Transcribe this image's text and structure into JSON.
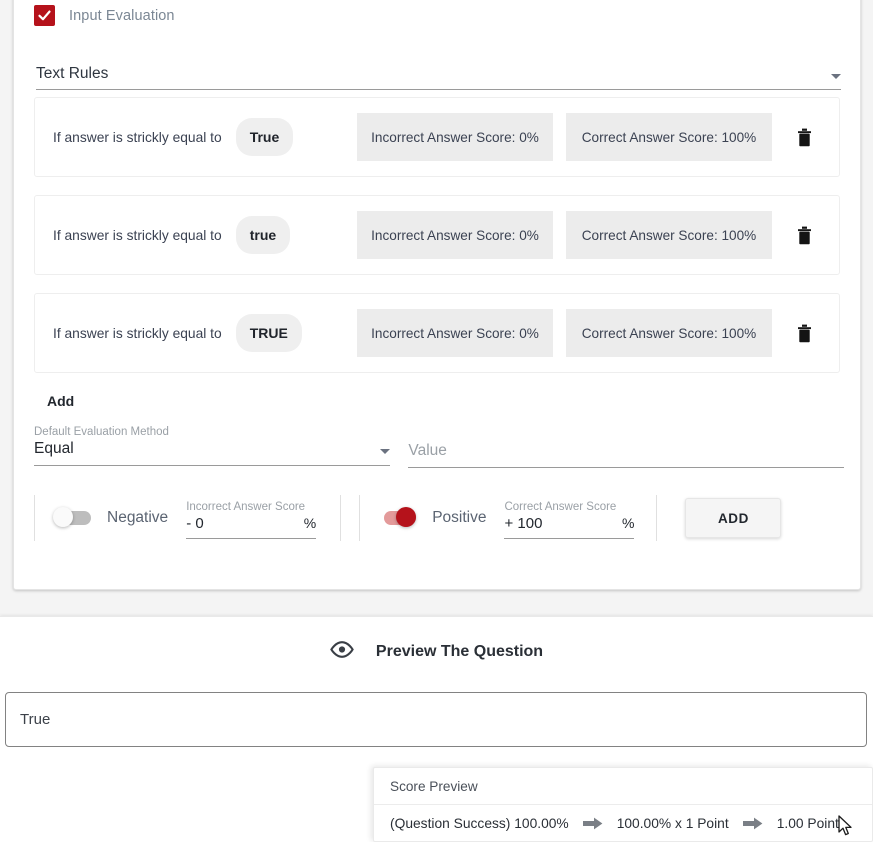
{
  "eval_section": {
    "checkbox_label": "Input Evaluation",
    "checkbox_checked": true,
    "checkbox_color": "#b5121b",
    "rules_select_label": "Text Rules",
    "rules": [
      {
        "condition": "If answer is strickly equal to",
        "value": "True",
        "incorrect": "Incorrect Answer Score: 0%",
        "correct": "Correct Answer Score: 100%",
        "delete_icon": "trash-icon"
      },
      {
        "condition": "If answer is strickly equal to",
        "value": "true",
        "incorrect": "Incorrect Answer Score: 0%",
        "correct": "Correct Answer Score: 100%",
        "delete_icon": "trash-icon"
      },
      {
        "condition": "If answer is strickly equal to",
        "value": "TRUE",
        "incorrect": "Incorrect Answer Score: 0%",
        "correct": "Correct Answer Score: 100%",
        "delete_icon": "trash-icon"
      }
    ],
    "add_label": "Add",
    "method": {
      "label": "Default Evaluation Method",
      "value": "Equal"
    },
    "value_field": {
      "placeholder": "Value",
      "value": ""
    },
    "negative": {
      "toggle_label": "Negative",
      "toggle_on": false,
      "score_label": "Incorrect Answer Score",
      "score_value": "- 0",
      "unit": "%"
    },
    "positive": {
      "toggle_label": "Positive",
      "toggle_on": true,
      "score_label": "Correct Answer Score",
      "score_value": "+ 100",
      "unit": "%"
    },
    "add_button_label": "ADD"
  },
  "preview_section": {
    "icon": "eye-icon",
    "title": "Preview The Question",
    "answer_value": "True",
    "score_preview": {
      "title": "Score Preview",
      "step1": "(Question Success) 100.00%",
      "step2": "100.00% x 1 Point",
      "step3": "1.00 Point",
      "arrow_icon": "arrow-right-icon"
    }
  }
}
